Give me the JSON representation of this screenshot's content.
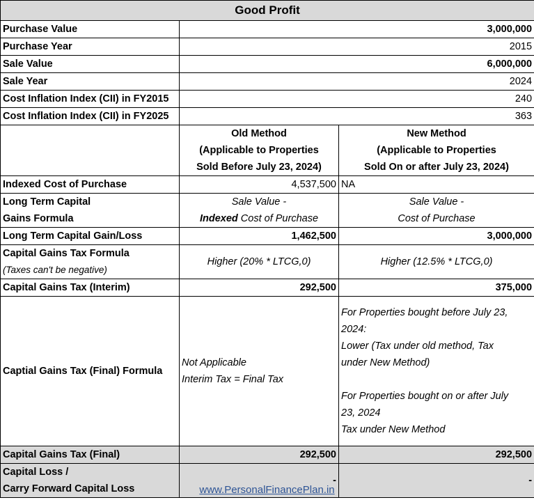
{
  "title": "Good Profit",
  "rows": {
    "purchase_value": {
      "label": "Purchase Value",
      "value": "3,000,000"
    },
    "purchase_year": {
      "label": "Purchase Year",
      "value": "2015"
    },
    "sale_value": {
      "label": "Sale Value",
      "value": "6,000,000"
    },
    "sale_year": {
      "label": "Sale Year",
      "value": "2024"
    },
    "cii_2015": {
      "label": "Cost Inflation Index (CII) in FY2015",
      "value": "240"
    },
    "cii_2025": {
      "label": "Cost Inflation Index (CII) in FY2025",
      "value": "363"
    }
  },
  "methods": {
    "old": {
      "line1": "Old Method",
      "line2": "(Applicable to Properties",
      "line3": "Sold Before July 23, 2024)"
    },
    "new": {
      "line1": "New Method",
      "line2": "(Applicable to Properties",
      "line3": "Sold On or after July 23, 2024)"
    }
  },
  "indexed_cost": {
    "label": "Indexed Cost of Purchase",
    "old": "4,537,500",
    "new": "NA"
  },
  "ltcg_formula": {
    "label1": "Long Term Capital",
    "label2": "Gains Formula",
    "old1": "Sale Value -",
    "old2_bold": "Indexed",
    "old2_rest": " Cost of Purchase",
    "new1": "Sale Value -",
    "new2": "Cost of Purchase"
  },
  "ltcg": {
    "label": "Long Term Capital Gain/Loss",
    "old": "1,462,500",
    "new": "3,000,000"
  },
  "cgt_formula": {
    "label": "Capital Gains Tax Formula",
    "note": "(Taxes can't be negative)",
    "old": "Higher (20% * LTCG,0)",
    "new": "Higher (12.5% * LTCG,0)"
  },
  "cgt_interim": {
    "label": "Capital Gains Tax (Interim)",
    "old": "292,500",
    "new": "375,000"
  },
  "final_formula": {
    "label": "Captial Gains Tax (Final) Formula",
    "old1": "Not Applicable",
    "old2": "Interim Tax = Final Tax",
    "new1": " For Properties bought before July 23,",
    "new2": "2024:",
    "new3": "Lower (Tax under old method, Tax",
    "new4": "under New Method)",
    "new5": "For Properties bought on or after July",
    "new6": "23, 2024",
    "new7": "Tax under New Method"
  },
  "cgt_final": {
    "label": "Capital Gains Tax (Final)",
    "old": "292,500",
    "new": "292,500"
  },
  "capital_loss": {
    "label1": "Capital Loss /",
    "label2": "Carry Forward Capital Loss",
    "old": "-",
    "new": "-"
  },
  "footer": {
    "link": "www.PersonalFinancePlan.in"
  }
}
